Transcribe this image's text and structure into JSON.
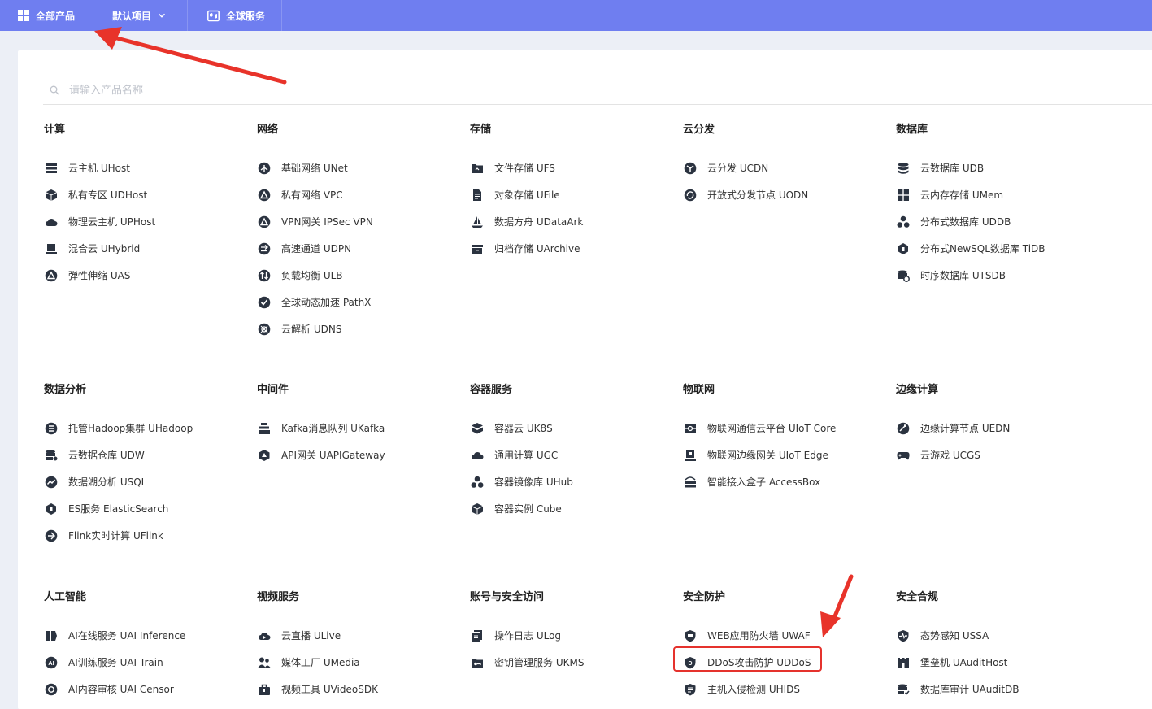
{
  "topbar": {
    "all_products": "全部产品",
    "default_project": "默认项目",
    "global_services": "全球服务"
  },
  "search": {
    "placeholder": "请输入产品名称"
  },
  "categories": [
    {
      "title": "计算",
      "items": [
        {
          "label": "云主机 UHost",
          "icon": "server-icon"
        },
        {
          "label": "私有专区 UDHost",
          "icon": "cube-icon"
        },
        {
          "label": "物理云主机 UPHost",
          "icon": "cloud-icon"
        },
        {
          "label": "混合云 UHybrid",
          "icon": "drive-icon"
        },
        {
          "label": "弹性伸缩 UAS",
          "icon": "triangle-icon"
        }
      ]
    },
    {
      "title": "网络",
      "items": [
        {
          "label": "基础网络 UNet",
          "icon": "network-icon"
        },
        {
          "label": "私有网络 VPC",
          "icon": "triangle-icon"
        },
        {
          "label": "VPN网关 IPSec VPN",
          "icon": "triangle-icon"
        },
        {
          "label": "高速通道 UDPN",
          "icon": "arrows-icon"
        },
        {
          "label": "负载均衡 ULB",
          "icon": "balance-icon"
        },
        {
          "label": "全球动态加速 PathX",
          "icon": "check-circle-icon"
        },
        {
          "label": "云解析 UDNS",
          "icon": "dns-icon"
        }
      ]
    },
    {
      "title": "存储",
      "items": [
        {
          "label": "文件存储 UFS",
          "icon": "folder-icon"
        },
        {
          "label": "对象存储 UFile",
          "icon": "file-icon"
        },
        {
          "label": "数据方舟 UDataArk",
          "icon": "ship-icon"
        },
        {
          "label": "归档存储 UArchive",
          "icon": "archive-icon"
        }
      ]
    },
    {
      "title": "云分发",
      "items": [
        {
          "label": "云分发 UCDN",
          "icon": "cdn-icon"
        },
        {
          "label": "开放式分发节点 UODN",
          "icon": "node-icon"
        }
      ]
    },
    {
      "title": "数据库",
      "items": [
        {
          "label": "云数据库 UDB",
          "icon": "database-icon"
        },
        {
          "label": "云内存存储 UMem",
          "icon": "grid-icon"
        },
        {
          "label": "分布式数据库 UDDB",
          "icon": "cluster-icon"
        },
        {
          "label": "分布式NewSQL数据库 TiDB",
          "icon": "hexagon-icon"
        },
        {
          "label": "时序数据库 UTSDB",
          "icon": "timeseries-icon"
        }
      ]
    },
    {
      "title": "数据分析",
      "items": [
        {
          "label": "托管Hadoop集群 UHadoop",
          "icon": "hadoop-icon"
        },
        {
          "label": "云数据仓库  UDW",
          "icon": "warehouse-icon"
        },
        {
          "label": "数据湖分析 USQL",
          "icon": "chart-icon"
        },
        {
          "label": "ES服务 ElasticSearch",
          "icon": "hexagon-icon"
        },
        {
          "label": "Flink实时计算 UFlink",
          "icon": "flink-icon"
        }
      ]
    },
    {
      "title": "中间件",
      "items": [
        {
          "label": "Kafka消息队列 UKafka",
          "icon": "queue-icon"
        },
        {
          "label": "API网关 UAPIGateway",
          "icon": "gateway-icon"
        }
      ]
    },
    {
      "title": "容器服务",
      "items": [
        {
          "label": "容器云 UK8S",
          "icon": "container-icon"
        },
        {
          "label": "通用计算 UGC",
          "icon": "cloud-icon"
        },
        {
          "label": "容器镜像库 UHub",
          "icon": "cluster-icon"
        },
        {
          "label": "容器实例 Cube",
          "icon": "cube-icon"
        }
      ]
    },
    {
      "title": "物联网",
      "items": [
        {
          "label": "物联网通信云平台 UIoT Core",
          "icon": "iot-icon"
        },
        {
          "label": "物联网边缘网关 UIoT Edge",
          "icon": "chip-icon"
        },
        {
          "label": "智能接入盒子 AccessBox",
          "icon": "router-icon"
        }
      ]
    },
    {
      "title": "边缘计算",
      "items": [
        {
          "label": "边缘计算节点 UEDN",
          "icon": "edge-icon"
        },
        {
          "label": "云游戏 UCGS",
          "icon": "gamepad-icon"
        }
      ]
    },
    {
      "title": "人工智能",
      "items": [
        {
          "label": "AI在线服务 UAI Inference",
          "icon": "ai-online-icon"
        },
        {
          "label": "AI训练服务 UAI Train",
          "icon": "ai-icon"
        },
        {
          "label": "AI内容审核 UAI Censor",
          "icon": "censor-icon"
        }
      ]
    },
    {
      "title": "视频服务",
      "items": [
        {
          "label": "云直播 ULive",
          "icon": "cloud-play-icon"
        },
        {
          "label": "媒体工厂 UMedia",
          "icon": "people-icon"
        },
        {
          "label": "视频工具 UVideoSDK",
          "icon": "toolbox-icon"
        }
      ]
    },
    {
      "title": "账号与安全访问",
      "items": [
        {
          "label": "操作日志 ULog",
          "icon": "log-icon"
        },
        {
          "label": "密钥管理服务 UKMS",
          "icon": "key-folder-icon"
        }
      ]
    },
    {
      "title": "安全防护",
      "items": [
        {
          "label": "WEB应用防火墙 UWAF",
          "icon": "shield-icon"
        },
        {
          "label": "DDoS攻击防护 UDDoS",
          "icon": "shield-d-icon"
        },
        {
          "label": "主机入侵检测 UHIDS",
          "icon": "shield-list-icon"
        }
      ]
    },
    {
      "title": "安全合规",
      "items": [
        {
          "label": "态势感知 USSA",
          "icon": "shield-pulse-icon"
        },
        {
          "label": "堡垒机 UAuditHost",
          "icon": "fortress-icon"
        },
        {
          "label": "数据库审计 UAuditDB",
          "icon": "db-audit-icon"
        }
      ]
    }
  ]
}
